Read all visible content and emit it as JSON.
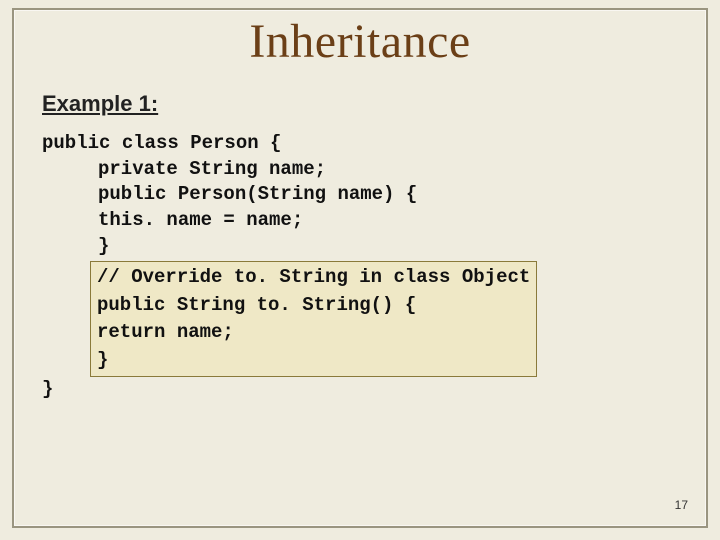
{
  "title": "Inheritance",
  "subhead": "Example 1:",
  "code": {
    "l1": "public class Person {",
    "l2": "private String name;",
    "l3": "public Person(String name) {",
    "l4": "this. name = name;",
    "l5": "}",
    "box_l1": "// Override to. String in class Object",
    "box_l2": "public String to. String() {",
    "box_l3": "return name;",
    "box_l4": "}",
    "l6": "}"
  },
  "page_number": "17"
}
